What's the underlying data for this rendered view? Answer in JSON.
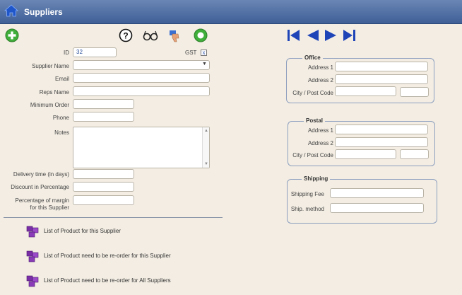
{
  "window": {
    "title": "Suppliers"
  },
  "toolbar": {
    "add_icon": "plus-circle-icon",
    "help_icon": "question-icon",
    "view_icon": "glasses-icon",
    "feedback_icon": "thumbs-down-icon",
    "go_icon": "green-circle-icon"
  },
  "nav": {
    "first": "first-record-icon",
    "prev": "previous-record-icon",
    "next": "next-record-icon",
    "last": "last-record-icon"
  },
  "form": {
    "id_label": "ID",
    "id_value": "32",
    "gst_label": "GST",
    "gst_checked": "x",
    "supplier_name_label": "Supplier Name",
    "supplier_name_value": "",
    "email_label": "Email",
    "email_value": "",
    "reps_name_label": "Reps Name",
    "reps_name_value": "",
    "minimum_order_label": "Minimum Order",
    "minimum_order_value": "",
    "phone_label": "Phone",
    "phone_value": "",
    "notes_label": "Notes",
    "notes_value": "",
    "delivery_label": "Delivery time (in days)",
    "delivery_value": "",
    "discount_label": "Discount in Percentage",
    "discount_value": "",
    "margin_label_1": "Percentage of margin",
    "margin_label_2": "for this Supplier",
    "margin_value": ""
  },
  "office": {
    "title": "Office",
    "address1_label": "Address 1",
    "address2_label": "Address 2",
    "city_label": "City / Post Code"
  },
  "postal": {
    "title": "Postal",
    "address1_label": "Address 1",
    "address2_label": "Address 2",
    "city_label": "City / Post Code"
  },
  "shipping": {
    "title": "Shipping",
    "fee_label": "Shipping Fee",
    "method_label": "Ship. method"
  },
  "links": [
    "List of Product for this Supplier",
    "List of Product need to be re-order for this Supplier",
    "List of Product need to be re-order for All Suppliers"
  ],
  "colors": {
    "titlebar": "#4f6ea3",
    "background": "#f3ede3",
    "accent": "#1e44b8"
  }
}
